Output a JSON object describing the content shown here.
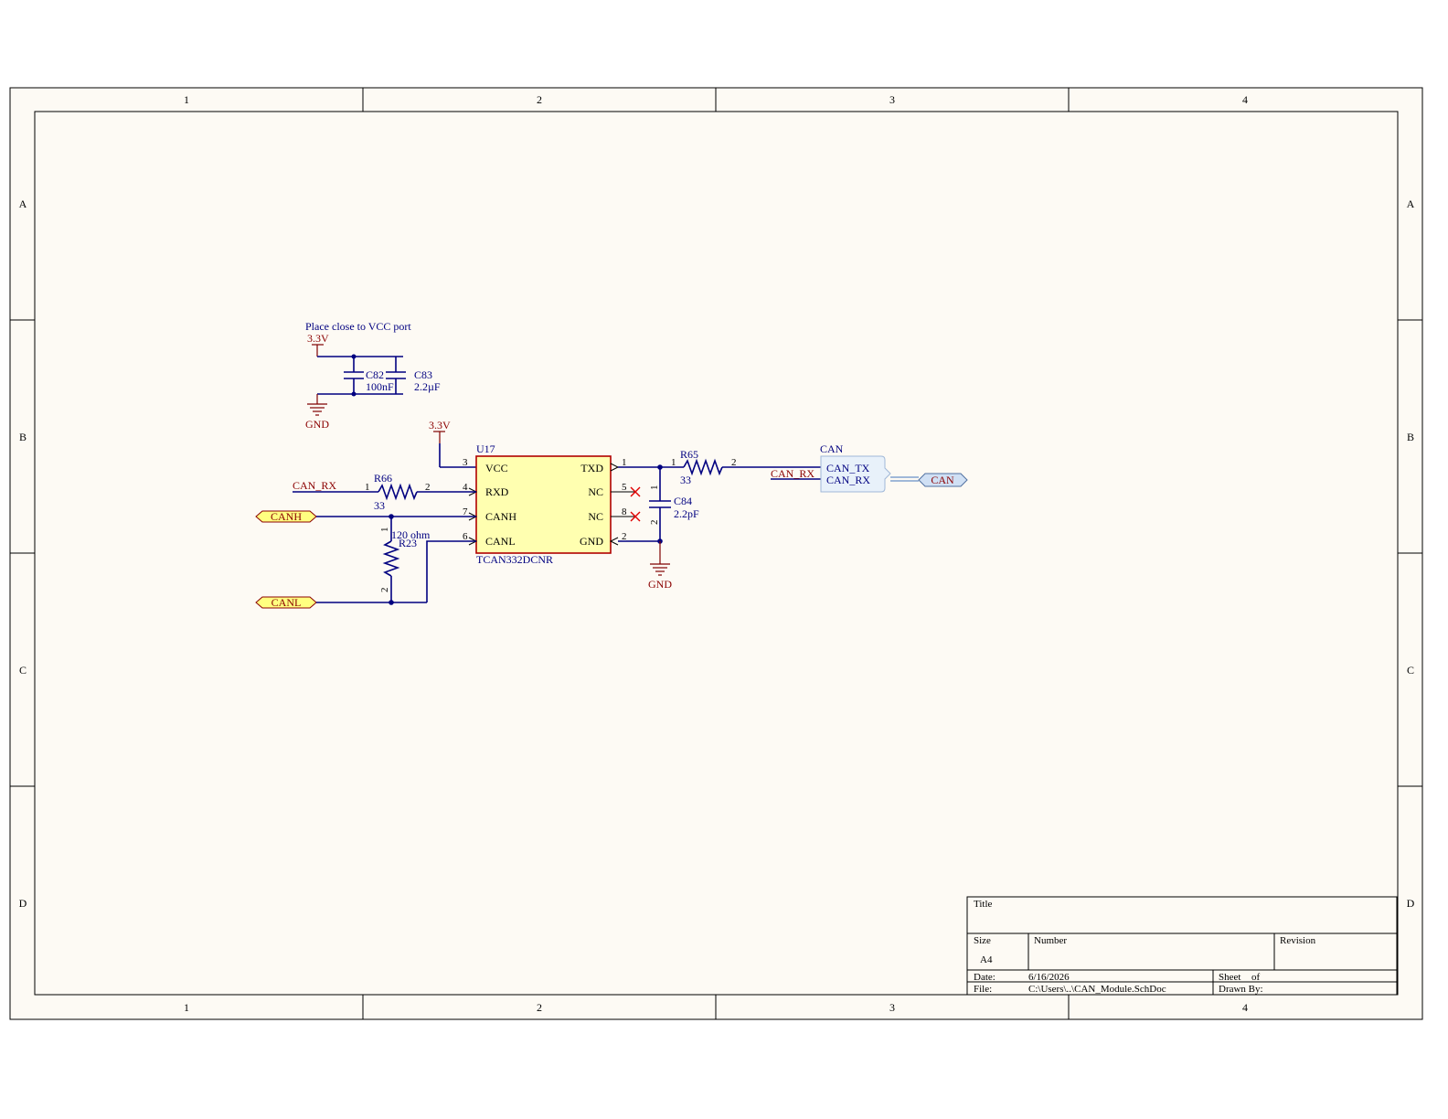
{
  "sheet": {
    "columns": [
      "1",
      "2",
      "3",
      "4"
    ],
    "rows": [
      "A",
      "B",
      "C",
      "D"
    ]
  },
  "note": {
    "text": "Place close to VCC port"
  },
  "power": {
    "vcc_label": "3.3V",
    "gnd_label": "GND"
  },
  "caps": {
    "c82": {
      "ref": "C82",
      "value": "100nF"
    },
    "c83": {
      "ref": "C83",
      "value": "2.2µF"
    },
    "c84": {
      "ref": "C84",
      "value": "2.2pF",
      "pin1": "1",
      "pin2": "2"
    }
  },
  "ic": {
    "ref": "U17",
    "part": "TCAN332DCNR",
    "left_pins": [
      {
        "num": "3",
        "name": "VCC"
      },
      {
        "num": "4",
        "name": "RXD"
      },
      {
        "num": "7",
        "name": "CANH"
      },
      {
        "num": "6",
        "name": "CANL"
      }
    ],
    "right_pins": [
      {
        "num": "1",
        "name": "TXD"
      },
      {
        "num": "5",
        "name": "NC"
      },
      {
        "num": "8",
        "name": "NC"
      },
      {
        "num": "2",
        "name": "GND"
      }
    ]
  },
  "resistors": {
    "r66": {
      "ref": "R66",
      "value": "33",
      "pin1": "1",
      "pin2": "2"
    },
    "r65": {
      "ref": "R65",
      "value": "33",
      "pin1": "1",
      "pin2": "2"
    },
    "r23": {
      "ref": "R23",
      "value": "120 ohm",
      "pin1": "1",
      "pin2": "2"
    }
  },
  "nets": {
    "can_rx_left": "CAN_RX",
    "can_rx_right": "CAN_RX"
  },
  "ports": {
    "canh": "CANH",
    "canl": "CANL",
    "can": "CAN"
  },
  "harness": {
    "title": "CAN",
    "entries": [
      "CAN_TX",
      "CAN_RX"
    ]
  },
  "title_block": {
    "title_label": "Title",
    "size_label": "Size",
    "size_value": "A4",
    "number_label": "Number",
    "revision_label": "Revision",
    "date_label": "Date:",
    "date_value": "6/16/2026",
    "file_label": "File:",
    "file_value": "C:\\Users\\..\\CAN_Module.SchDoc",
    "sheet_label": "Sheet",
    "of_label": "of",
    "drawn_by_label": "Drawn By:"
  },
  "colors": {
    "sheet_bg": "#fdfaf4",
    "wire": "#000080",
    "power": "#800000",
    "ic_fill": "#ffffb0",
    "ic_border": "#b00000",
    "port_fill": "#ffff80",
    "no_connect": "#e00000"
  }
}
